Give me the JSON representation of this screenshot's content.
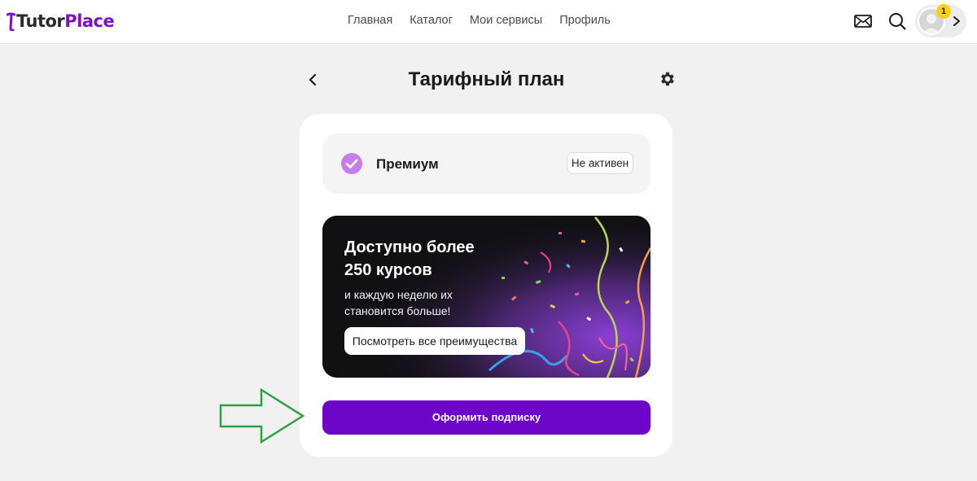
{
  "header": {
    "logo": {
      "part1": "Tutor",
      "part2": "Place"
    },
    "nav": [
      {
        "label": "Главная"
      },
      {
        "label": "Каталог"
      },
      {
        "label": "Мои сервисы"
      },
      {
        "label": "Профиль"
      }
    ],
    "icons": [
      "mail-icon",
      "search-icon",
      "avatar",
      "chevron-right-icon"
    ],
    "notification_count": "1"
  },
  "page": {
    "title": "Тарифный план",
    "icons": [
      "chevron-left-icon",
      "gear-icon"
    ]
  },
  "plan": {
    "name": "Премиум",
    "status": "Не активен",
    "icon": "check-circle-icon"
  },
  "promo": {
    "title_line1": "Доступно более",
    "title_line2": "250 курсов",
    "subtitle_line1": "и каждую неделю их",
    "subtitle_line2": "становится больше!",
    "button_label": "Посмотреть все преимущества"
  },
  "subscribe_button": "Оформить подписку",
  "colors": {
    "brand": "#7a12c9",
    "primary_button": "#6e06c9",
    "badge": "#f7d117",
    "annotation_arrow": "#2ea043"
  }
}
